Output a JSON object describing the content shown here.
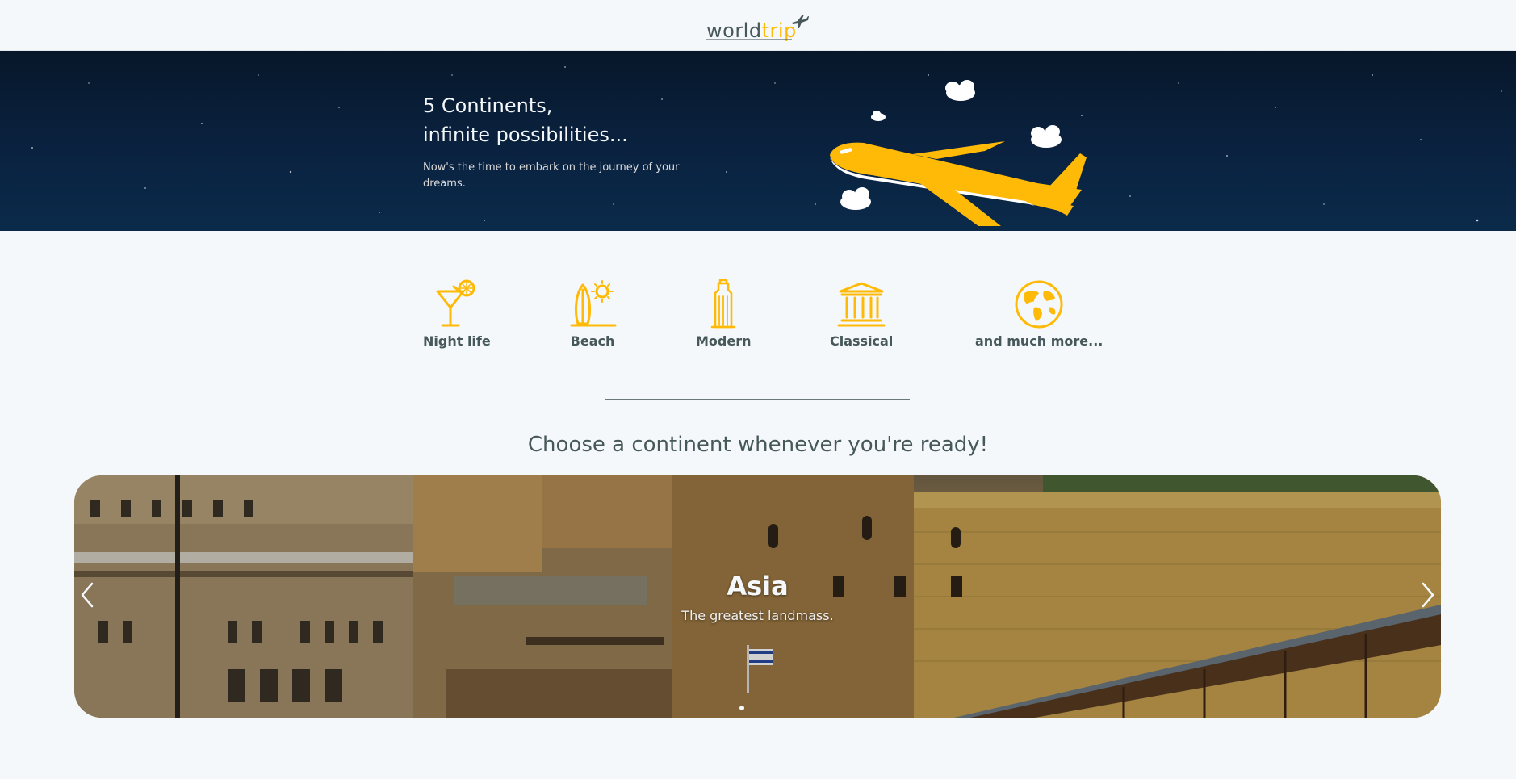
{
  "header": {
    "logo_part1": "world",
    "logo_part2": "trip",
    "logo_icon": "airplane-icon"
  },
  "banner": {
    "title_line1": "5 Continents,",
    "title_line2": "infinite possibilities...",
    "subtitle": "Now's the time to embark on the journey of your dreams.",
    "illustration": "airplane-illustration"
  },
  "categories": [
    {
      "label": "Night life",
      "icon": "cocktail-icon"
    },
    {
      "label": "Beach",
      "icon": "surfboard-sun-icon"
    },
    {
      "label": "Modern",
      "icon": "skyscraper-icon"
    },
    {
      "label": "Classical",
      "icon": "museum-icon"
    },
    {
      "label": "and much more...",
      "icon": "globe-icon"
    }
  ],
  "section": {
    "title": "Choose a continent whenever you're ready!"
  },
  "carousel": {
    "slide_title": "Asia",
    "slide_subtitle": "The greatest landmass.",
    "prev_icon": "chevron-left-icon",
    "next_icon": "chevron-right-icon"
  },
  "colors": {
    "accent": "#ffba08",
    "text": "#47585b",
    "background": "#f5f8fa",
    "banner": "#0a2240"
  }
}
